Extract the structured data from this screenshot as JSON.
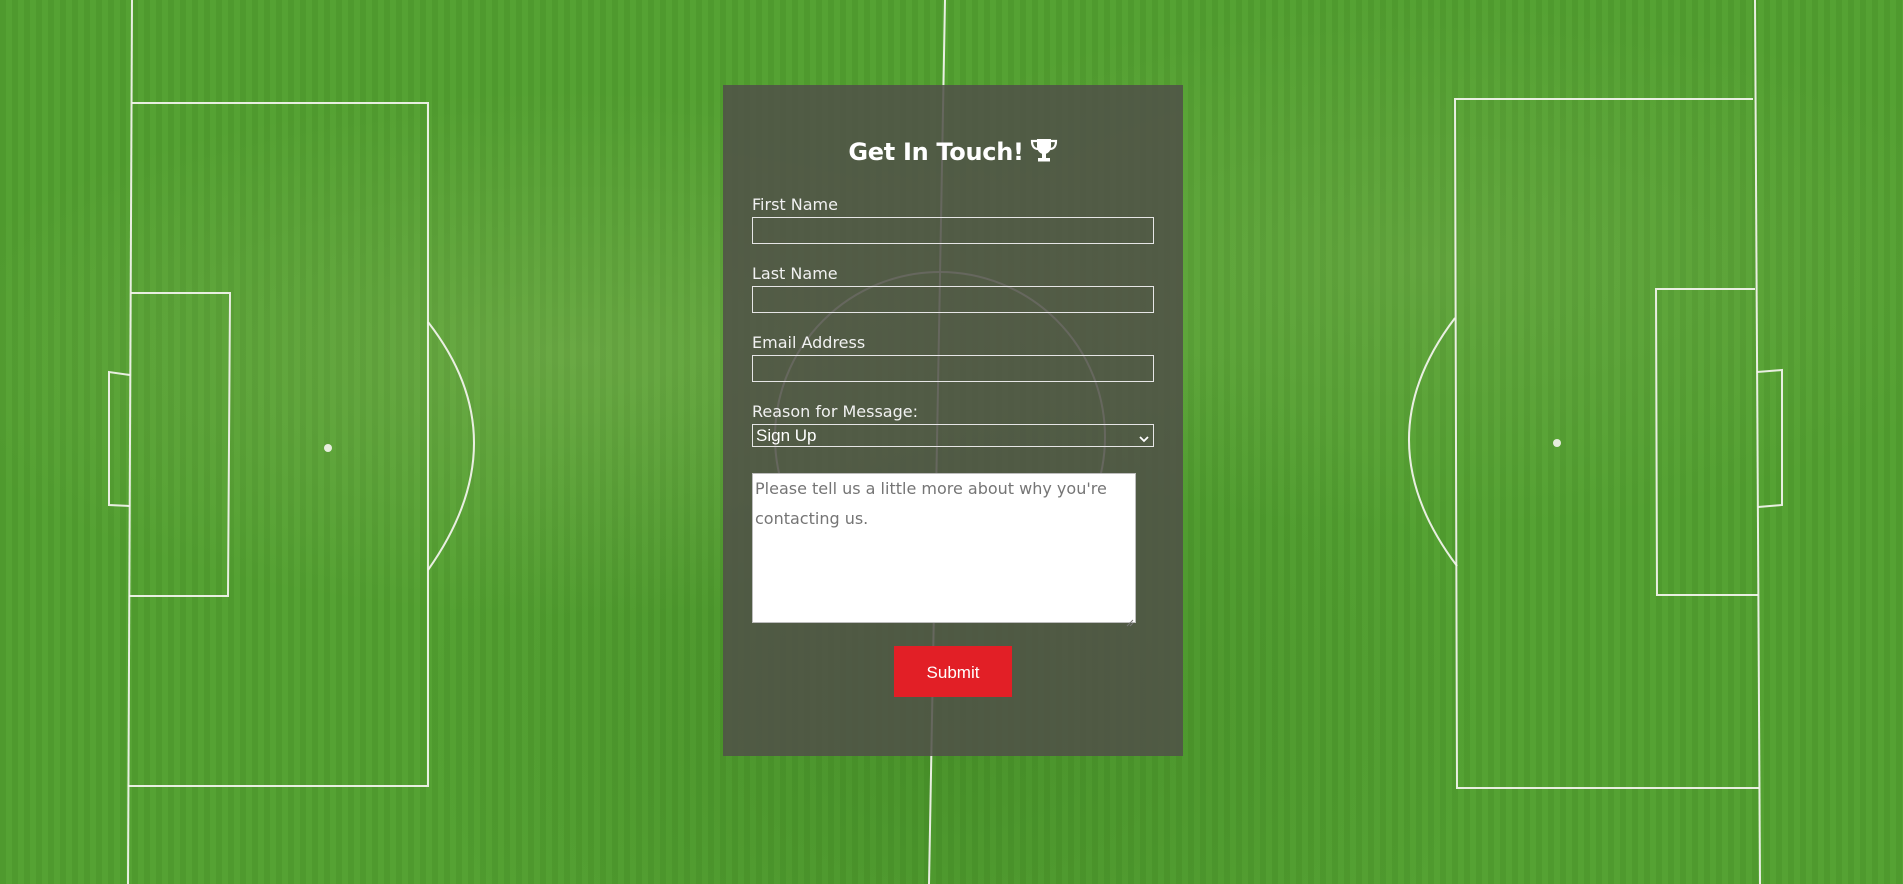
{
  "form": {
    "title": "Get In Touch!",
    "title_icon": "trophy-icon",
    "fields": {
      "first_name": {
        "label": "First Name",
        "value": ""
      },
      "last_name": {
        "label": "Last Name",
        "value": ""
      },
      "email": {
        "label": "Email Address",
        "value": ""
      },
      "reason": {
        "label": "Reason for Message:",
        "selected": "Sign Up"
      },
      "message": {
        "placeholder": "Please tell us a little more about why you're contacting us.",
        "value": ""
      }
    },
    "submit_label": "Submit"
  },
  "colors": {
    "grass": "#4f9a2e",
    "panel": "#50504899",
    "accent": "#e21f26"
  }
}
